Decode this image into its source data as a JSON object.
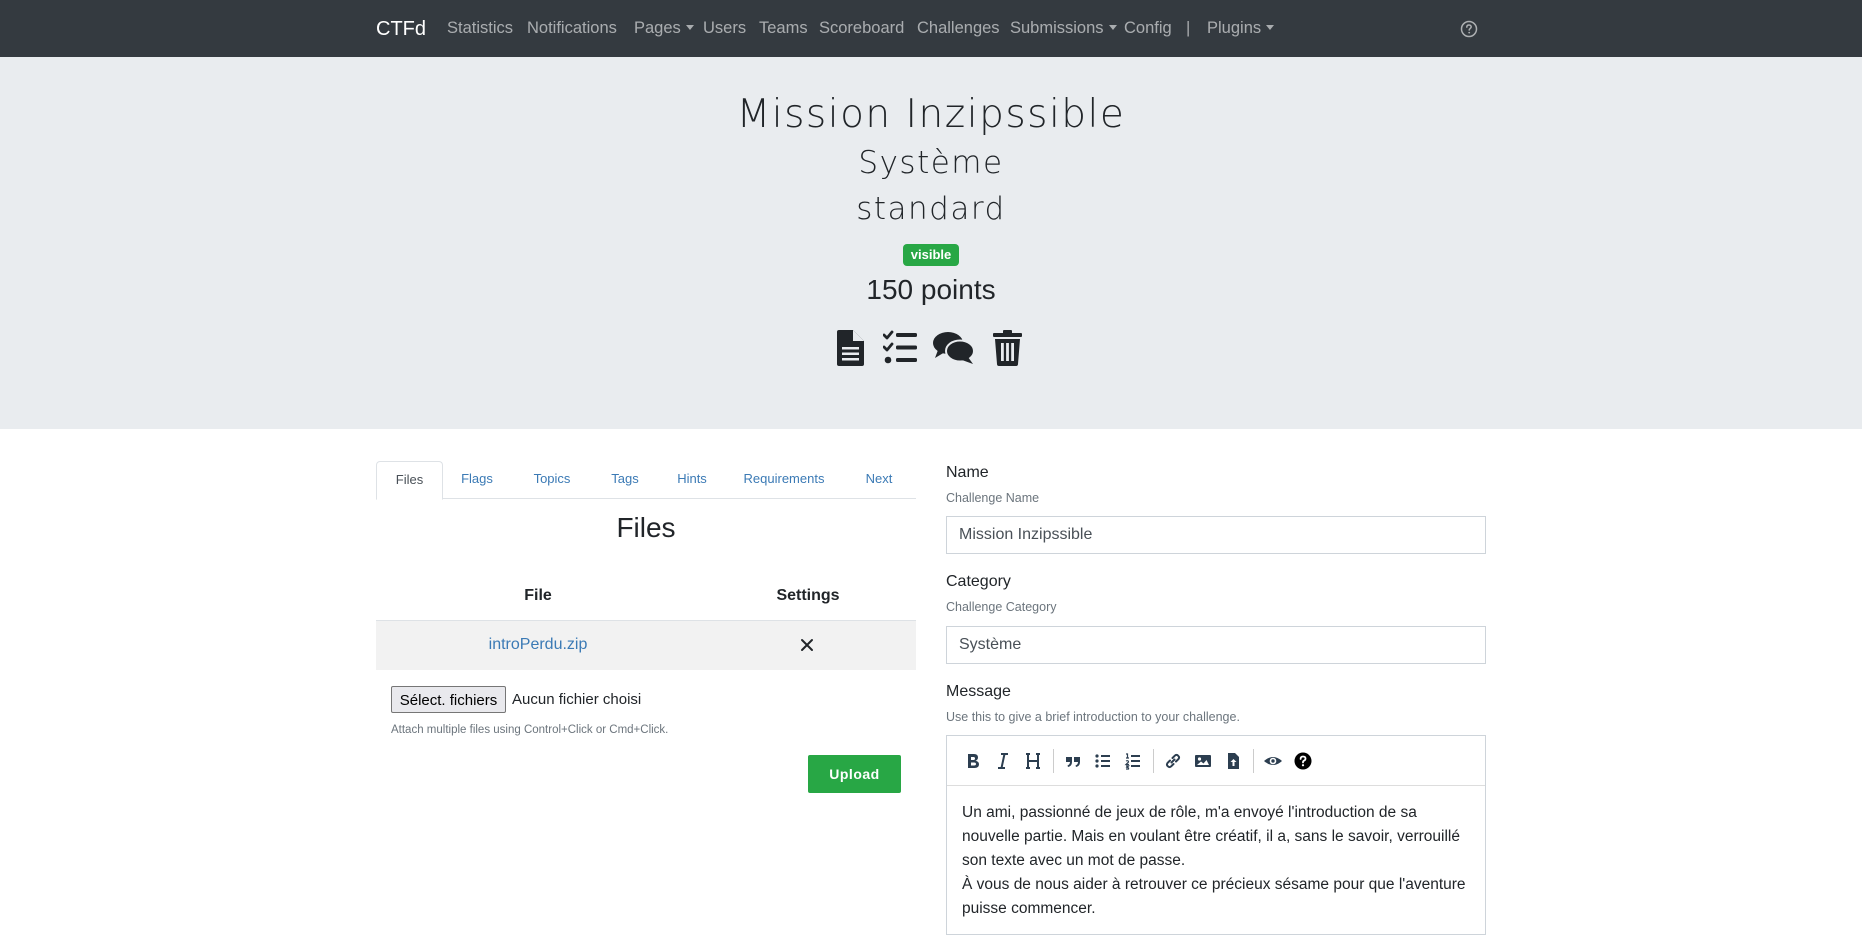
{
  "navbar": {
    "brand": "CTFd",
    "items": [
      {
        "label": "Statistics"
      },
      {
        "label": "Notifications"
      },
      {
        "label": "Pages"
      },
      {
        "label": "Users"
      },
      {
        "label": "Teams"
      },
      {
        "label": "Scoreboard"
      },
      {
        "label": "Challenges"
      },
      {
        "label": "Submissions"
      },
      {
        "label": "Config"
      },
      {
        "label": "|"
      },
      {
        "label": "Plugins"
      }
    ],
    "help_icon": "question-circle-icon"
  },
  "challenge": {
    "name": "Mission Inzipssible",
    "category": "Système",
    "type": "standard",
    "state": "visible",
    "value": "150 points",
    "actions": [
      {
        "name": "file-icon"
      },
      {
        "name": "checklist-icon"
      },
      {
        "name": "comments-icon"
      },
      {
        "name": "trash-icon"
      }
    ],
    "colors": {
      "badge": "#28a745",
      "link": "#3b7ab5",
      "navbar": "#343a40",
      "jumbotron": "#e9ecef"
    }
  },
  "tabs": [
    {
      "label": "Files",
      "active": true
    },
    {
      "label": "Flags"
    },
    {
      "label": "Topics"
    },
    {
      "label": "Tags"
    },
    {
      "label": "Hints"
    },
    {
      "label": "Requirements"
    },
    {
      "label": "Next"
    }
  ],
  "files": {
    "title": "Files",
    "headers": {
      "file": "File",
      "settings": "Settings"
    },
    "rows": [
      {
        "name": "introPerdu.zip"
      }
    ],
    "chooser_button": "Sélect. fichiers",
    "chooser_status": "Aucun fichier choisi",
    "help": "Attach multiple files using Control+Click or Cmd+Click.",
    "upload": "Upload"
  },
  "form": {
    "name": {
      "label": "Name",
      "sub": "Challenge Name",
      "value": "Mission Inzipssible"
    },
    "category": {
      "label": "Category",
      "sub": "Challenge Category",
      "value": "Système"
    },
    "message": {
      "label": "Message",
      "sub": "Use this to give a brief introduction to your challenge.",
      "text": "Un ami, passionné de jeux de rôle, m'a envoyé l'introduction de sa nouvelle partie. Mais en voulant être créatif, il a, sans le savoir, verrouillé son texte avec un mot de passe.",
      "text2": "À vous de nous aider à retrouver ce précieux sésame pour que l'aventure puisse commencer."
    },
    "toolbar": [
      "bold-icon",
      "italic-icon",
      "heading-icon",
      "quote-icon",
      "unordered-list-icon",
      "ordered-list-icon",
      "link-icon",
      "image-icon",
      "upload-file-icon",
      "preview-icon",
      "guide-icon"
    ]
  }
}
